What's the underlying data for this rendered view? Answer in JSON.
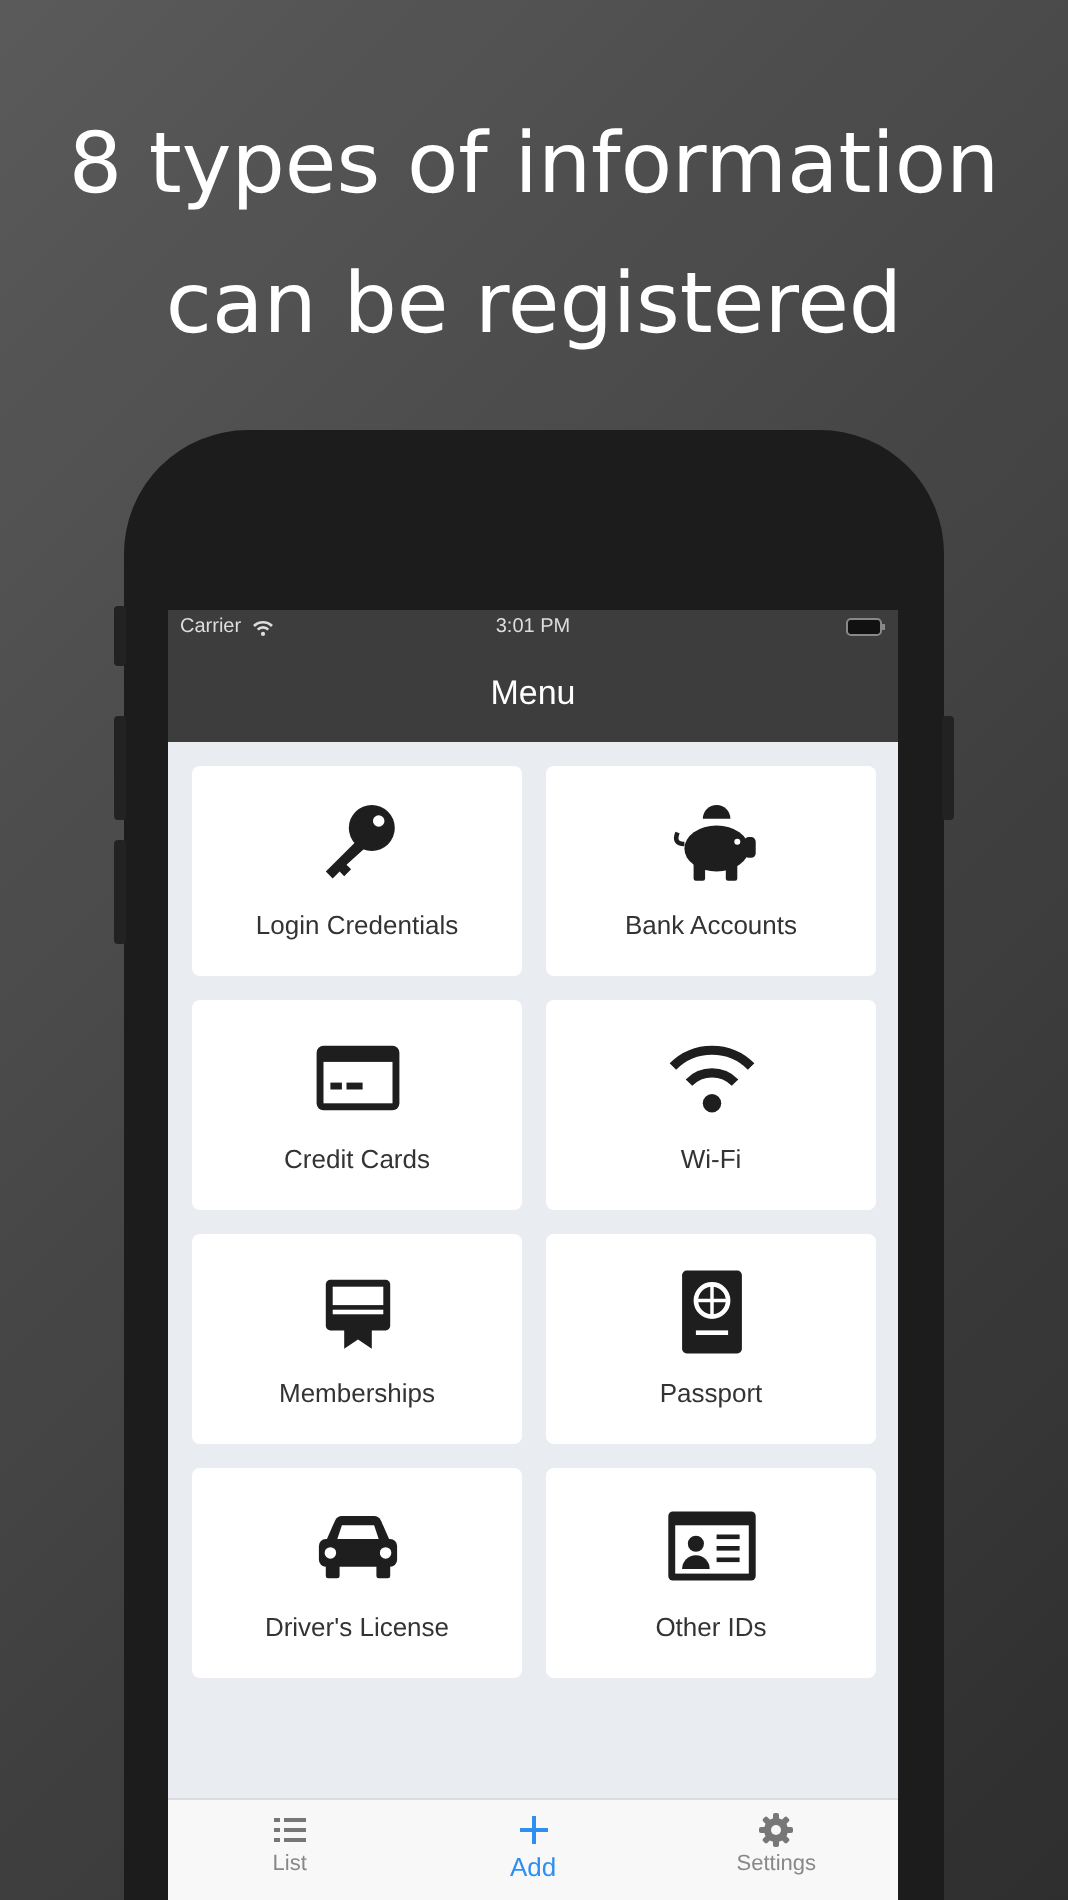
{
  "headline": "8 types of information can be registered",
  "status_bar": {
    "carrier": "Carrier",
    "time": "3:01 PM"
  },
  "nav": {
    "title": "Menu"
  },
  "menu_items": [
    {
      "label": "Login Credentials"
    },
    {
      "label": "Bank Accounts"
    },
    {
      "label": "Credit Cards"
    },
    {
      "label": "Wi-Fi"
    },
    {
      "label": "Memberships"
    },
    {
      "label": "Passport"
    },
    {
      "label": "Driver's License"
    },
    {
      "label": "Other IDs"
    }
  ],
  "tabs": [
    {
      "label": "List",
      "selected": false
    },
    {
      "label": "Add",
      "selected": true
    },
    {
      "label": "Settings",
      "selected": false
    }
  ]
}
